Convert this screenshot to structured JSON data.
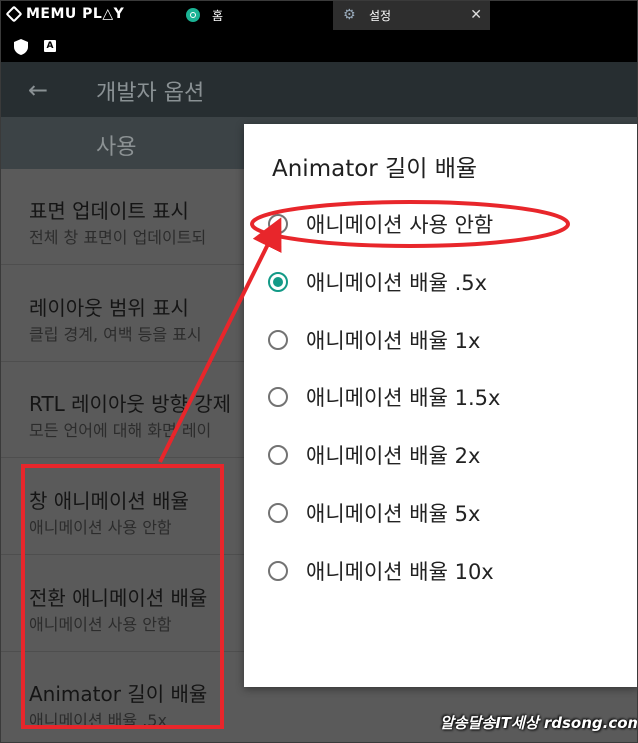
{
  "emulator": {
    "logo": "MEMU PL△Y",
    "tabs": [
      {
        "label": "홈",
        "icon": "home-app-icon"
      },
      {
        "label": "설정",
        "icon": "gear-icon",
        "close": "✕"
      }
    ]
  },
  "statusbar": {
    "icons": [
      "shield-icon",
      "a-icon"
    ],
    "a_label": "A"
  },
  "appbar": {
    "back": "←",
    "title": "개발자 옵션"
  },
  "use_band": {
    "label": "사용"
  },
  "list": [
    {
      "title": "표면 업데이트 표시",
      "subtitle": "전체 창 표면이 업데이트되"
    },
    {
      "title": "레이아웃 범위 표시",
      "subtitle": "클립 경계, 여백 등을 표시"
    },
    {
      "title": "RTL 레이아웃 방향 강제",
      "subtitle": "모든 언어에 대해 화면 레이"
    },
    {
      "title": "창 애니메이션 배율",
      "subtitle": "애니메이션 사용 안함"
    },
    {
      "title": "전환 애니메이션 배율",
      "subtitle": "애니메이션 사용 안함"
    },
    {
      "title": "Animator 길이 배율",
      "subtitle": "애니메이션 배율 .5x"
    }
  ],
  "dialog": {
    "title": "Animator 길이 배율",
    "selected_index": 1,
    "options": [
      "애니메이션 사용 안함",
      "애니메이션 배율 .5x",
      "애니메이션 배율 1x",
      "애니메이션 배율 1.5x",
      "애니메이션 배율 2x",
      "애니메이션 배율 5x",
      "애니메이션 배율 10x"
    ]
  },
  "annotation": {
    "color": "#e8262b"
  },
  "watermark": "알송달송IT세상 rdsong.com",
  "colors": {
    "accent": "#139a87",
    "appbar": "#272e31",
    "dim_list": "#5a5a5a"
  }
}
